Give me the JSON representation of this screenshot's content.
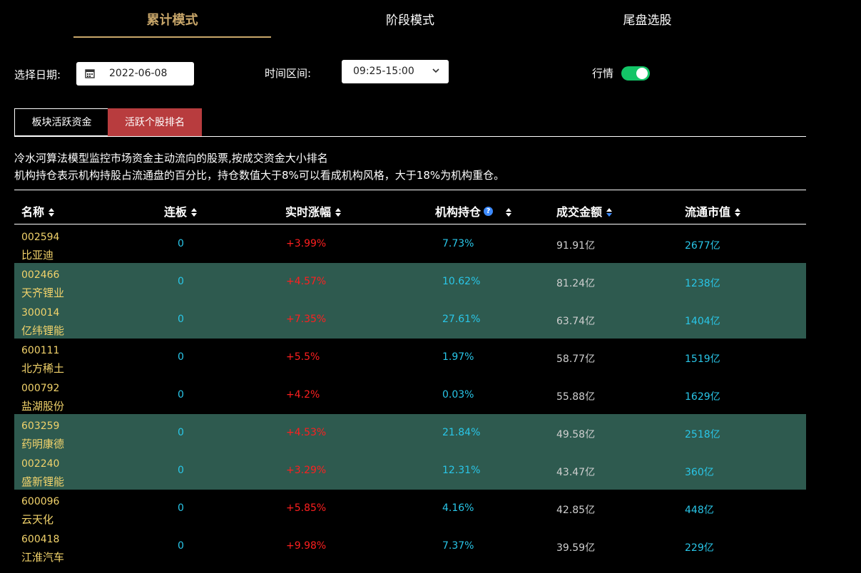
{
  "tabs": [
    "累计模式",
    "阶段模式",
    "尾盘选股"
  ],
  "filters": {
    "date_label": "选择日期:",
    "date_value": "2022-06-08",
    "time_label": "时间区间:",
    "time_value": "09:25-15:00",
    "market_label": "行情",
    "market_on": true
  },
  "sub_tabs": [
    "板块活跃资金",
    "活跃个股排名"
  ],
  "description": {
    "line1": "冷水河算法模型监控市场资金主动流向的股票,按成交资金大小排名",
    "line2": "机构持仓表示机构持股占流通盘的百分比，持仓数值大于8%可以看成机构风格，大于18%为机构重仓。"
  },
  "table": {
    "headers": [
      "名称",
      "连板",
      "实时涨幅",
      "机构持仓",
      "成交金额",
      "流通市值"
    ],
    "rows": [
      {
        "code": "002594",
        "name": "比亚迪",
        "lianban": "0",
        "change": "+3.99%",
        "inst": "7.73%",
        "amount": "91.91亿",
        "cap": "2677亿",
        "hl": false
      },
      {
        "code": "002466",
        "name": "天齐锂业",
        "lianban": "0",
        "change": "+4.57%",
        "inst": "10.62%",
        "amount": "81.24亿",
        "cap": "1238亿",
        "hl": true
      },
      {
        "code": "300014",
        "name": "亿纬锂能",
        "lianban": "0",
        "change": "+7.35%",
        "inst": "27.61%",
        "amount": "63.74亿",
        "cap": "1404亿",
        "hl": true
      },
      {
        "code": "600111",
        "name": "北方稀土",
        "lianban": "0",
        "change": "+5.5%",
        "inst": "1.97%",
        "amount": "58.77亿",
        "cap": "1519亿",
        "hl": false
      },
      {
        "code": "000792",
        "name": "盐湖股份",
        "lianban": "0",
        "change": "+4.2%",
        "inst": "0.03%",
        "amount": "55.88亿",
        "cap": "1629亿",
        "hl": false
      },
      {
        "code": "603259",
        "name": "药明康德",
        "lianban": "0",
        "change": "+4.53%",
        "inst": "21.84%",
        "amount": "49.58亿",
        "cap": "2518亿",
        "hl": true
      },
      {
        "code": "002240",
        "name": "盛新锂能",
        "lianban": "0",
        "change": "+3.29%",
        "inst": "12.31%",
        "amount": "43.47亿",
        "cap": "360亿",
        "hl": true
      },
      {
        "code": "600096",
        "name": "云天化",
        "lianban": "0",
        "change": "+5.85%",
        "inst": "4.16%",
        "amount": "42.85亿",
        "cap": "448亿",
        "hl": false
      },
      {
        "code": "600418",
        "name": "江淮汽车",
        "lianban": "0",
        "change": "+9.98%",
        "inst": "7.37%",
        "amount": "39.59亿",
        "cap": "229亿",
        "hl": false
      }
    ]
  },
  "colors": {
    "accent": "#c9a76a",
    "active_subtab": "#b83c3e",
    "highlight_row": "#2e5a4f",
    "toggle_on": "#13c567",
    "rise": "#ff1f1f",
    "cyan": "#29c6e8",
    "stock_name": "#f2d36b"
  }
}
